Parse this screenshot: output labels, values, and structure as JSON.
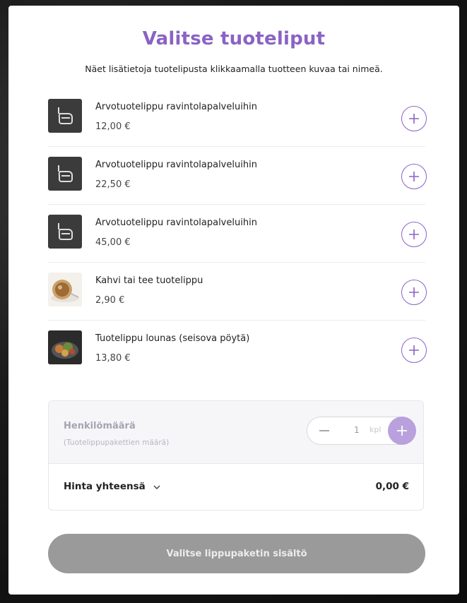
{
  "modal": {
    "title": "Valitse tuoteliput",
    "subtitle": "Näet lisätietoja tuotelipusta klikkaamalla tuotteen kuvaa tai nimeä."
  },
  "products": [
    {
      "name": "Arvotuotelippu ravintolapalveluihin",
      "price": "12,00 €",
      "thumb": "bag-icon"
    },
    {
      "name": "Arvotuotelippu ravintolapalveluihin",
      "price": "22,50 €",
      "thumb": "bag-icon"
    },
    {
      "name": "Arvotuotelippu ravintolapalveluihin",
      "price": "45,00 €",
      "thumb": "bag-icon"
    },
    {
      "name": "Kahvi tai tee tuotelippu",
      "price": "2,90 €",
      "thumb": "coffee-photo"
    },
    {
      "name": "Tuotelippu lounas (seisova pöytä)",
      "price": "13,80 €",
      "thumb": "lunch-photo"
    }
  ],
  "persons": {
    "label": "Henkilömäärä",
    "sublabel": "(Tuotelippupakettien määrä)",
    "value": "1",
    "unit": "kpl"
  },
  "total": {
    "label": "Hinta yhteensä",
    "value": "0,00 €"
  },
  "cta": {
    "label": "Valitse lippupaketin sisältö"
  },
  "colors": {
    "accent": "#8a63c4",
    "button_disabled": "#9a9a9a"
  }
}
